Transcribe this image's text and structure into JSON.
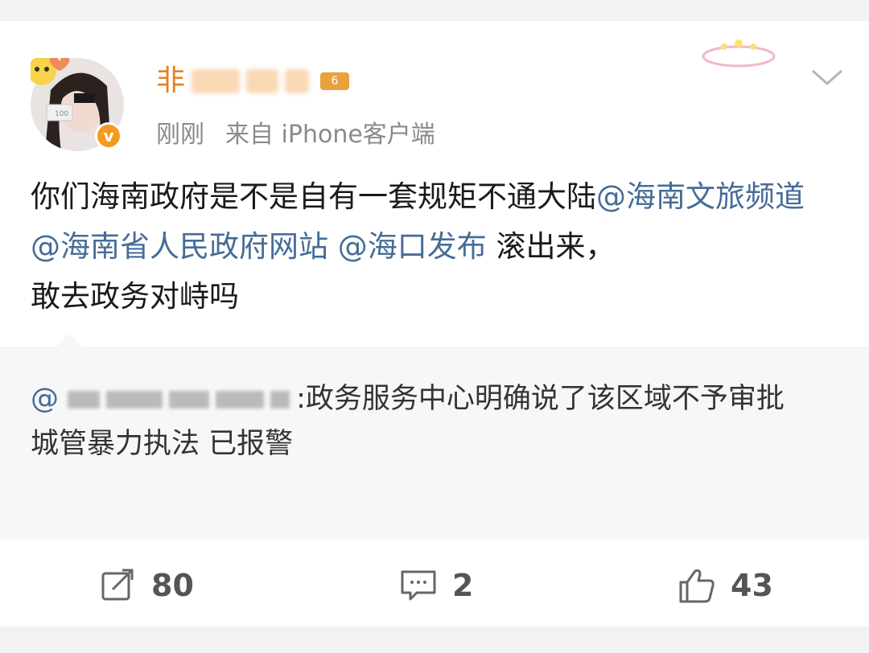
{
  "post": {
    "author": {
      "name_visible": "非",
      "member_badge": "6"
    },
    "time": "刚刚",
    "source": "来自 iPhone客户端",
    "text": {
      "p1": "你们海南政府是不是自有一套规矩不通大陆",
      "m1": "@海南文旅频道",
      "m2": "@海南省人民政府网站",
      "m3": "@海口发布",
      "p2": "滚出来，",
      "p3": "敢去政务对峙吗"
    }
  },
  "retweet": {
    "at": "@",
    "line1": ":政务服务中心明确说了该区域不予审批",
    "line2": "城管暴力执法 已报警"
  },
  "actions": {
    "repost_count": "80",
    "comment_count": "2",
    "like_count": "43"
  },
  "colors": {
    "mention": "#466c97",
    "username": "#e8801e",
    "verified": "#f39a1f",
    "text": "#1a1a1a",
    "meta": "#8a8a8a"
  },
  "icons": [
    "verified-v-icon",
    "chevron-down-icon",
    "repost-icon",
    "comment-icon",
    "like-icon"
  ]
}
